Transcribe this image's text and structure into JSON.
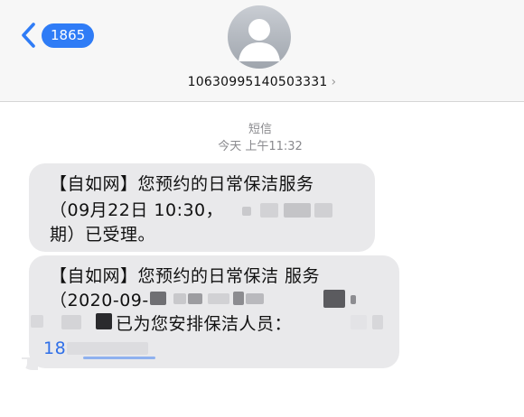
{
  "header": {
    "back_count": "1865",
    "contact_number": "10630995140503331",
    "contact_chevron": "›",
    "icons": {
      "back": "chevron-left-icon",
      "avatar": "person-avatar-icon"
    }
  },
  "conversation": {
    "service_label": "短信",
    "timestamp": "今天 上午11:32"
  },
  "messages": [
    {
      "lines": [
        "【自如网】您预约的日常保洁服务",
        "（09月22日 10:30，",
        "期）已受理。"
      ]
    },
    {
      "lines": [
        "【自如网】您预约的日常保洁 服务",
        "（2020-09-",
        "已为您安排保洁人员：",
        "18"
      ]
    }
  ],
  "colors": {
    "accent": "#2f7cf6",
    "bubble": "#e9e9eb",
    "meta": "#8a8a8e",
    "link": "#2f6fe8"
  }
}
